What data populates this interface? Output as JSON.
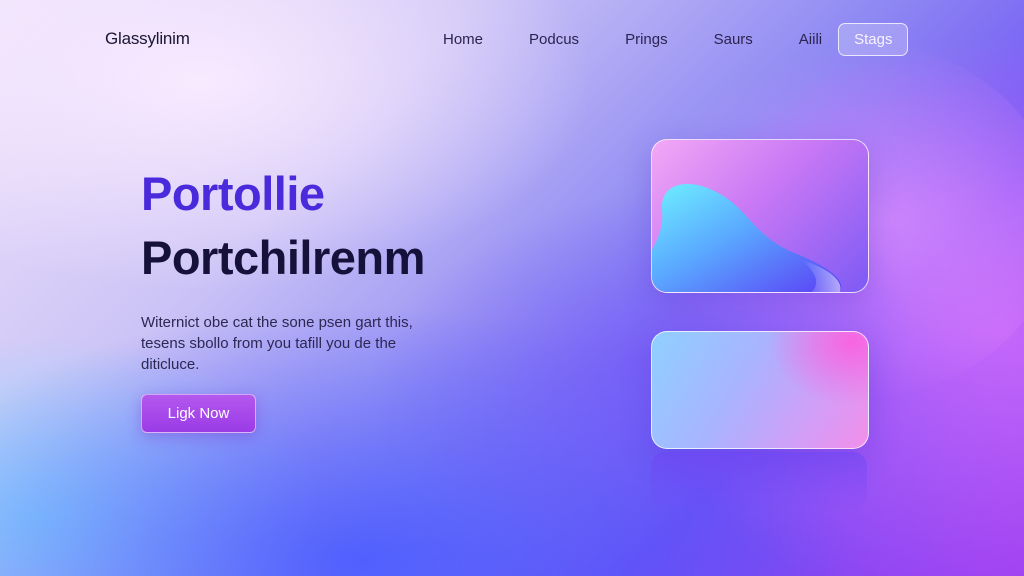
{
  "brand": {
    "name": "Glassylinim"
  },
  "nav": {
    "items": [
      "Home",
      "Podcus",
      "Prings",
      "Saurs",
      "Aiili"
    ],
    "cta_label": "Stags"
  },
  "hero": {
    "title_line1": "Portollie",
    "title_line2": "Portchilrenm",
    "description_lines": [
      "Witernict obe cat the sone psen gart this,",
      "tesens sbollo from you tafill you de the",
      "diticluce."
    ],
    "cta_label": "Ligk Now"
  },
  "colors": {
    "accent_purple": "#4a2bdc",
    "heading_dark": "#15113a",
    "button_purple": "#a84aea"
  }
}
